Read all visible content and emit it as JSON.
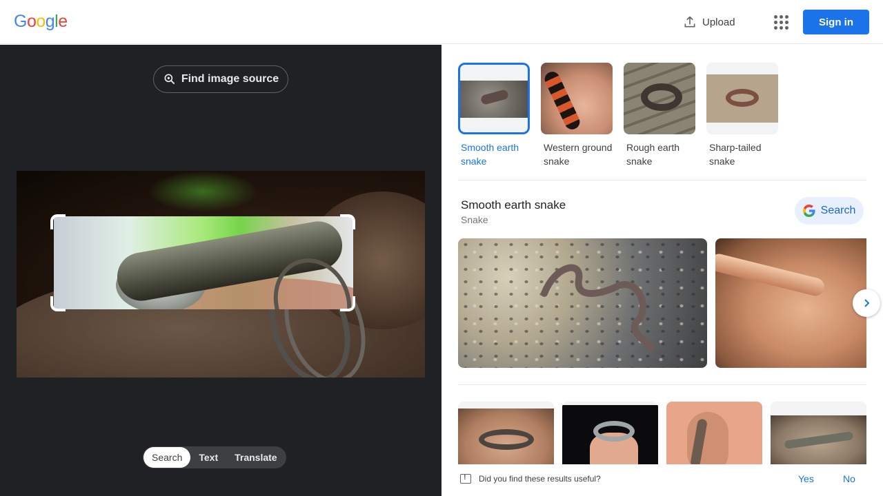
{
  "header": {
    "logo": "Google",
    "logo_colors": [
      "#4285f4",
      "#ea4335",
      "#fbbc05",
      "#4285f4",
      "#34a853",
      "#ea4335"
    ],
    "upload_label": "Upload",
    "upload_icon": "upload-icon",
    "apps_icon": "apps-grid-icon",
    "signin_label": "Sign in"
  },
  "lens": {
    "find_source_label": "Find image source",
    "modes": [
      {
        "label": "Search",
        "active": true
      },
      {
        "label": "Text",
        "active": false
      },
      {
        "label": "Translate",
        "active": false
      }
    ]
  },
  "results": {
    "chips": [
      {
        "label": "Smooth earth snake",
        "selected": true
      },
      {
        "label": "Western ground snake",
        "selected": false
      },
      {
        "label": "Rough earth snake",
        "selected": false
      },
      {
        "label": "Sharp-tailed snake",
        "selected": false
      }
    ],
    "entity": {
      "title": "Smooth earth snake",
      "subtitle": "Snake",
      "search_label": "Search"
    },
    "feedback": {
      "question": "Did you find these results useful?",
      "yes": "Yes",
      "no": "No"
    }
  },
  "colors": {
    "accent": "#1a73e8",
    "dark_panel": "#202124"
  }
}
